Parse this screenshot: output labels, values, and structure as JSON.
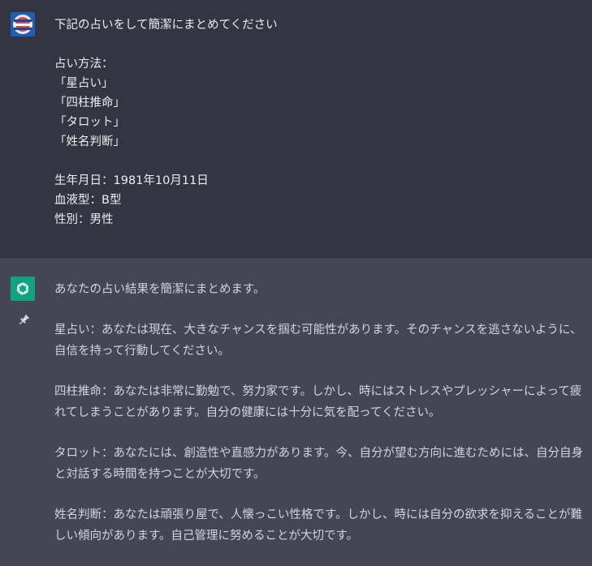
{
  "user_message": {
    "lines": [
      "下記の占いをして簡潔にまとめてください",
      "",
      "占い方法：",
      "「星占い」",
      "「四柱推命」",
      "「タロット」",
      "「姓名判断」",
      "",
      "生年月日：1981年10月11日",
      "血液型：B型",
      "性別：男性"
    ]
  },
  "assistant_message": {
    "paragraphs": [
      "あなたの占い結果を簡潔にまとめます。",
      "星占い：あなたは現在、大きなチャンスを掴む可能性があります。そのチャンスを逃さないように、自信を持って行動してください。",
      "四柱推命：あなたは非常に勤勉で、努力家です。しかし、時にはストレスやプレッシャーによって疲れてしまうことがあります。自分の健康には十分に気を配ってください。",
      "タロット：あなたには、創造性や直感力があります。今、自分が望む方向に進むためには、自分自身と対話する時間を持つことが大切です。",
      "姓名判断：あなたは頑張り屋で、人懐っこい性格です。しかし、時には自分の欲求を抑えることが難しい傾向があります。自己管理に努めることが大切です。"
    ]
  },
  "icons": {
    "user_avatar": "user-avatar-icon",
    "assistant_avatar": "openai-logo-icon",
    "pin": "pin-icon"
  },
  "colors": {
    "user_bg": "#343541",
    "assistant_bg": "#444654",
    "assistant_avatar_bg": "#10a37f",
    "text": "#d1d5db"
  }
}
